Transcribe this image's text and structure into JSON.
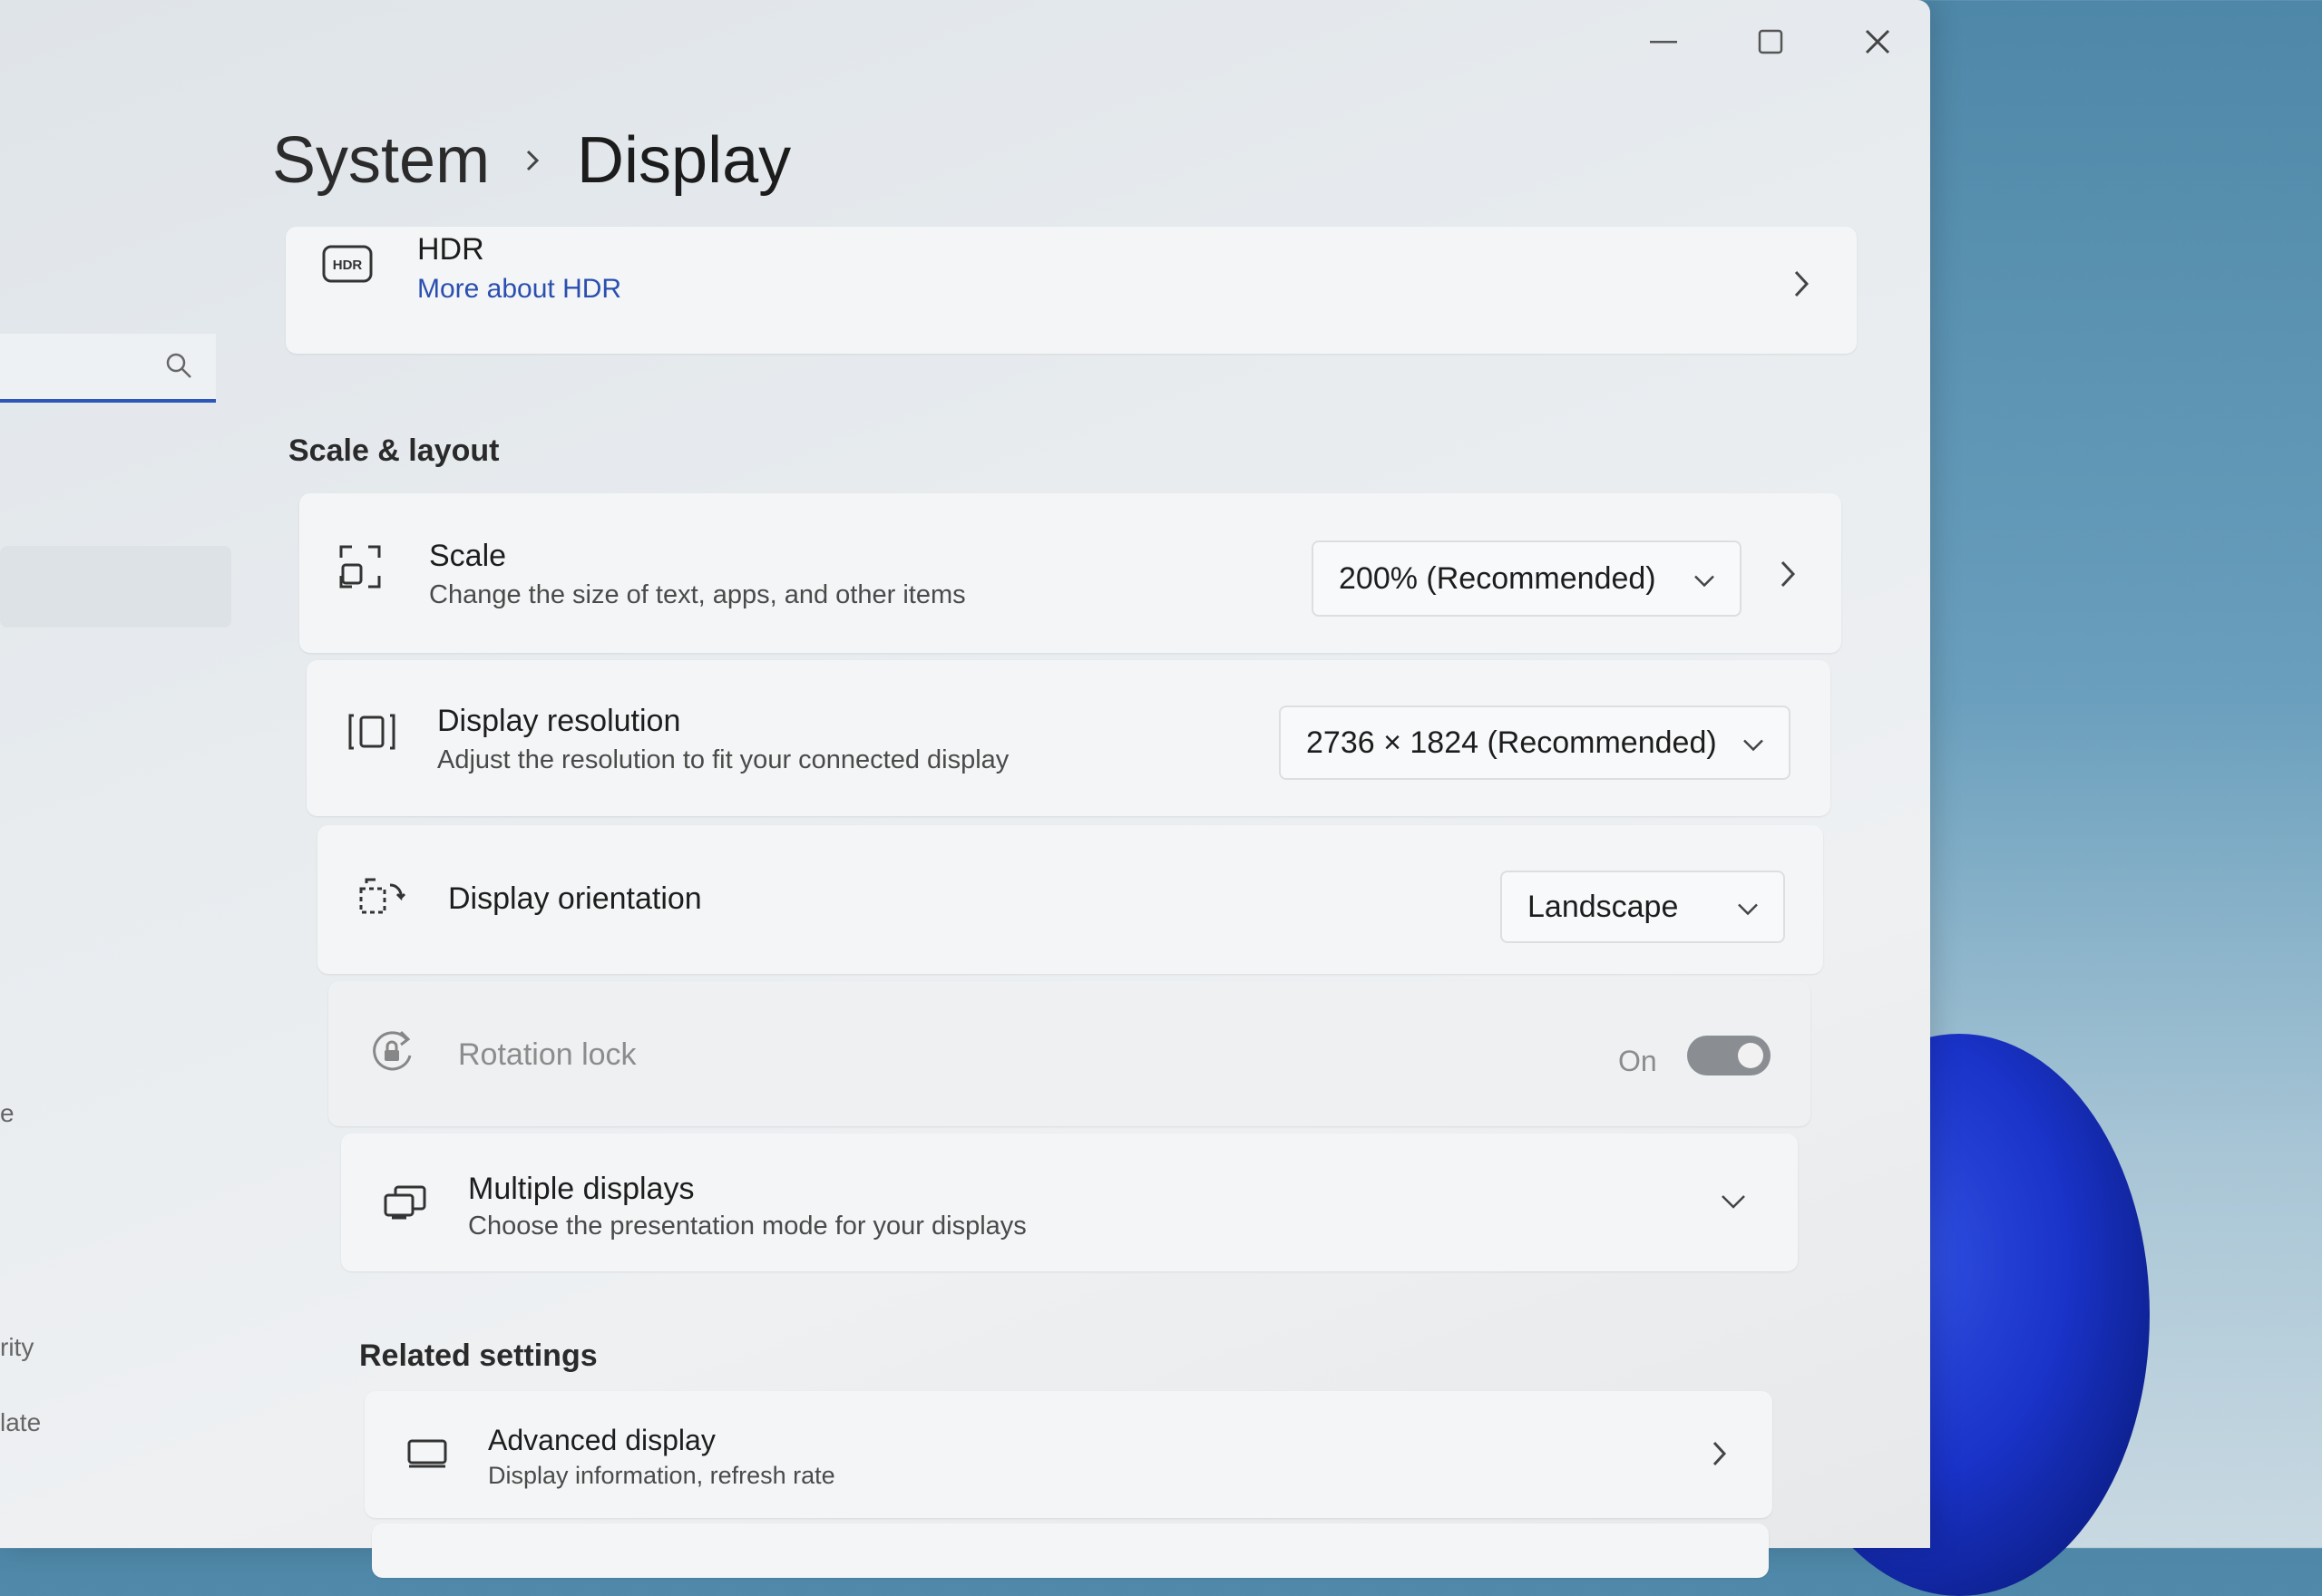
{
  "window": {
    "caption": {
      "minimize_icon": "minimize-icon",
      "maximize_icon": "maximize-icon",
      "close_icon": "close-icon"
    }
  },
  "sidebar": {
    "search": {
      "placeholder": "",
      "icon": "search-icon"
    },
    "partial_items": [
      "rity",
      "late"
    ],
    "partial_glyph": "e"
  },
  "breadcrumb": {
    "parent": "System",
    "current": "Display"
  },
  "hdr": {
    "title": "HDR",
    "link": "More about HDR",
    "icon": "hdr-icon"
  },
  "scale_layout": {
    "section_title": "Scale & layout",
    "scale": {
      "title": "Scale",
      "subtitle": "Change the size of text, apps, and other items",
      "value": "200% (Recommended)",
      "icon": "scale-icon"
    },
    "resolution": {
      "title": "Display resolution",
      "subtitle": "Adjust the resolution to fit your connected display",
      "value": "2736 × 1824 (Recommended)",
      "icon": "resolution-icon"
    },
    "orientation": {
      "title": "Display orientation",
      "value": "Landscape",
      "icon": "orientation-icon"
    },
    "rotation_lock": {
      "title": "Rotation lock",
      "state_label": "On",
      "enabled": false,
      "checked": true,
      "icon": "rotation-lock-icon"
    },
    "multiple_displays": {
      "title": "Multiple displays",
      "subtitle": "Choose the presentation mode for your displays",
      "icon": "multiple-displays-icon"
    }
  },
  "related": {
    "section_title": "Related settings",
    "advanced_display": {
      "title": "Advanced display",
      "subtitle": "Display information, refresh rate",
      "icon": "monitor-icon"
    }
  },
  "colors": {
    "accent": "#2e55b8",
    "link": "#2a4fb0",
    "toggle_disabled": "#8a8e92"
  }
}
